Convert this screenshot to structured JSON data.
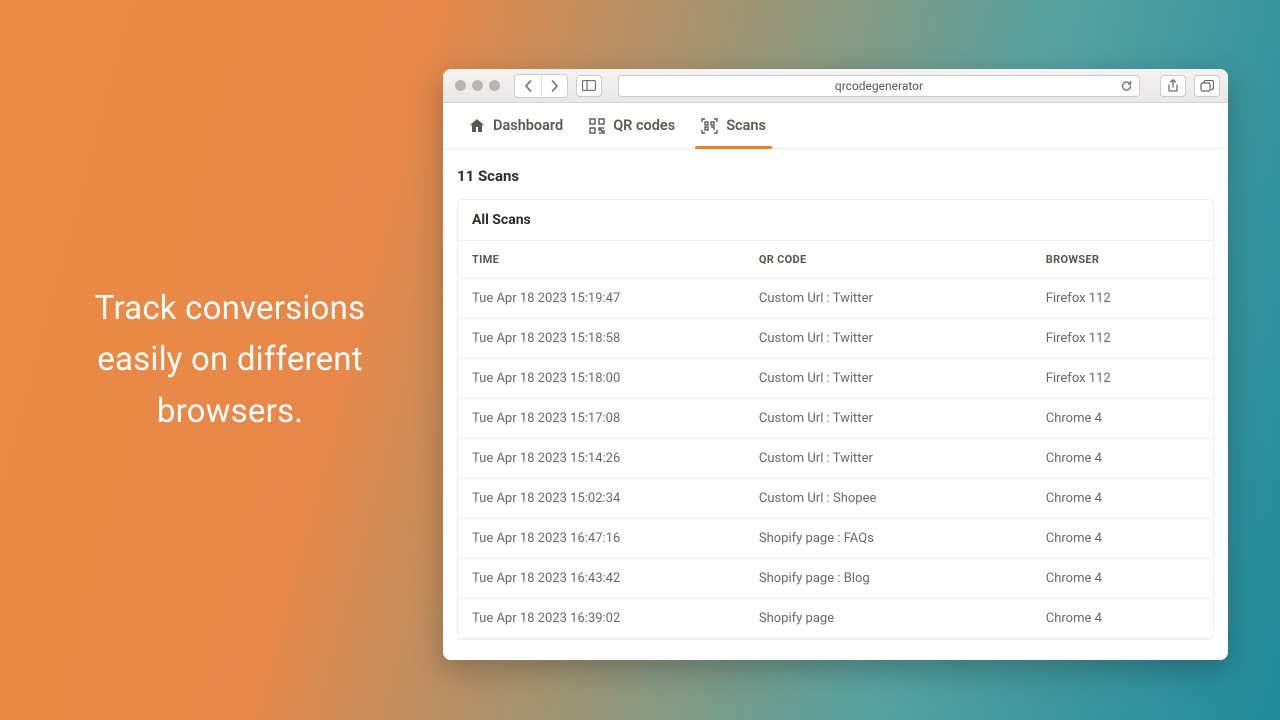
{
  "hero": {
    "line1": "Track conversions",
    "line2": "easily on different",
    "line3": "browsers."
  },
  "browser": {
    "url": "qrcodegenerator"
  },
  "tabs": {
    "dashboard": "Dashboard",
    "qrcodes": "QR codes",
    "scans": "Scans"
  },
  "page": {
    "title": "11 Scans",
    "panel_heading": "All Scans"
  },
  "columns": {
    "time": "TIME",
    "qr": "QR CODE",
    "browser": "BROWSER"
  },
  "rows": [
    {
      "time": "Tue Apr 18 2023 15:19:47",
      "qr": "Custom Url : Twitter",
      "browser": "Firefox 112"
    },
    {
      "time": "Tue Apr 18 2023 15:18:58",
      "qr": "Custom Url : Twitter",
      "browser": "Firefox 112"
    },
    {
      "time": "Tue Apr 18 2023 15:18:00",
      "qr": "Custom Url : Twitter",
      "browser": "Firefox 112"
    },
    {
      "time": "Tue Apr 18 2023 15:17:08",
      "qr": "Custom Url : Twitter",
      "browser": "Chrome 4"
    },
    {
      "time": "Tue Apr 18 2023 15:14:26",
      "qr": "Custom Url : Twitter",
      "browser": "Chrome 4"
    },
    {
      "time": "Tue Apr 18 2023 15:02:34",
      "qr": "Custom Url : Shopee",
      "browser": "Chrome 4"
    },
    {
      "time": "Tue Apr 18 2023 16:47:16",
      "qr": "Shopify page : FAQs",
      "browser": "Chrome 4"
    },
    {
      "time": "Tue Apr 18 2023 16:43:42",
      "qr": "Shopify page : Blog",
      "browser": "Chrome 4"
    },
    {
      "time": "Tue Apr 18 2023 16:39:02",
      "qr": "Shopify page",
      "browser": "Chrome 4"
    }
  ]
}
